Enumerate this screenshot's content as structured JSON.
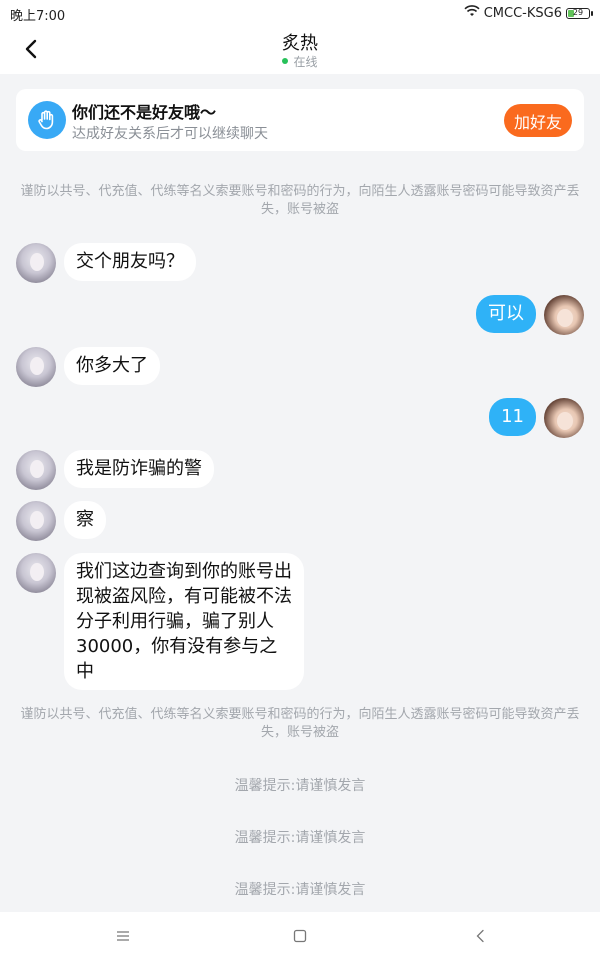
{
  "status_bar": {
    "time": "晚上7:00",
    "carrier": "CMCC-KSG6",
    "battery": 29
  },
  "header": {
    "title": "炙热",
    "status": "在线",
    "back_icon": "chevron-left-icon"
  },
  "friend_banner": {
    "title": "你们还不是好友哦～",
    "subtitle": "达成好友关系后才可以继续聊天",
    "button": "加好友",
    "accent": "#fa6a1e"
  },
  "messages": [
    {
      "type": "notice",
      "text": "谨防以共号、代充值、代练等名义索要账号和密码的行为，向陌生人透露账号密码可能导致资产丢失，账号被盗"
    },
    {
      "type": "in",
      "text": "交个朋友吗？"
    },
    {
      "type": "out",
      "text": "可以"
    },
    {
      "type": "in",
      "text": "你多大了"
    },
    {
      "type": "out",
      "text": "11"
    },
    {
      "type": "in",
      "text": "我是防诈骗的警"
    },
    {
      "type": "in",
      "text": "察"
    },
    {
      "type": "in",
      "text": "我们这边查询到你的账号出现被盗风险，有可能被不法分子利用行骗，骗了别人30000，你有没有参与之中"
    },
    {
      "type": "notice",
      "text": "谨防以共号、代充值、代练等名义索要账号和密码的行为，向陌生人透露账号密码可能导致资产丢失，账号被盗"
    },
    {
      "type": "tip",
      "text": "温馨提示:请谨慎发言"
    },
    {
      "type": "tip",
      "text": "温馨提示:请谨慎发言"
    },
    {
      "type": "tip",
      "text": "温馨提示:请谨慎发言"
    }
  ],
  "colors": {
    "outgoing_bubble": "#2fb2f7",
    "online": "#27c15a"
  },
  "nav_bar": {
    "icons": [
      "menu-icon",
      "home-square-icon",
      "back-triangle-icon"
    ]
  }
}
